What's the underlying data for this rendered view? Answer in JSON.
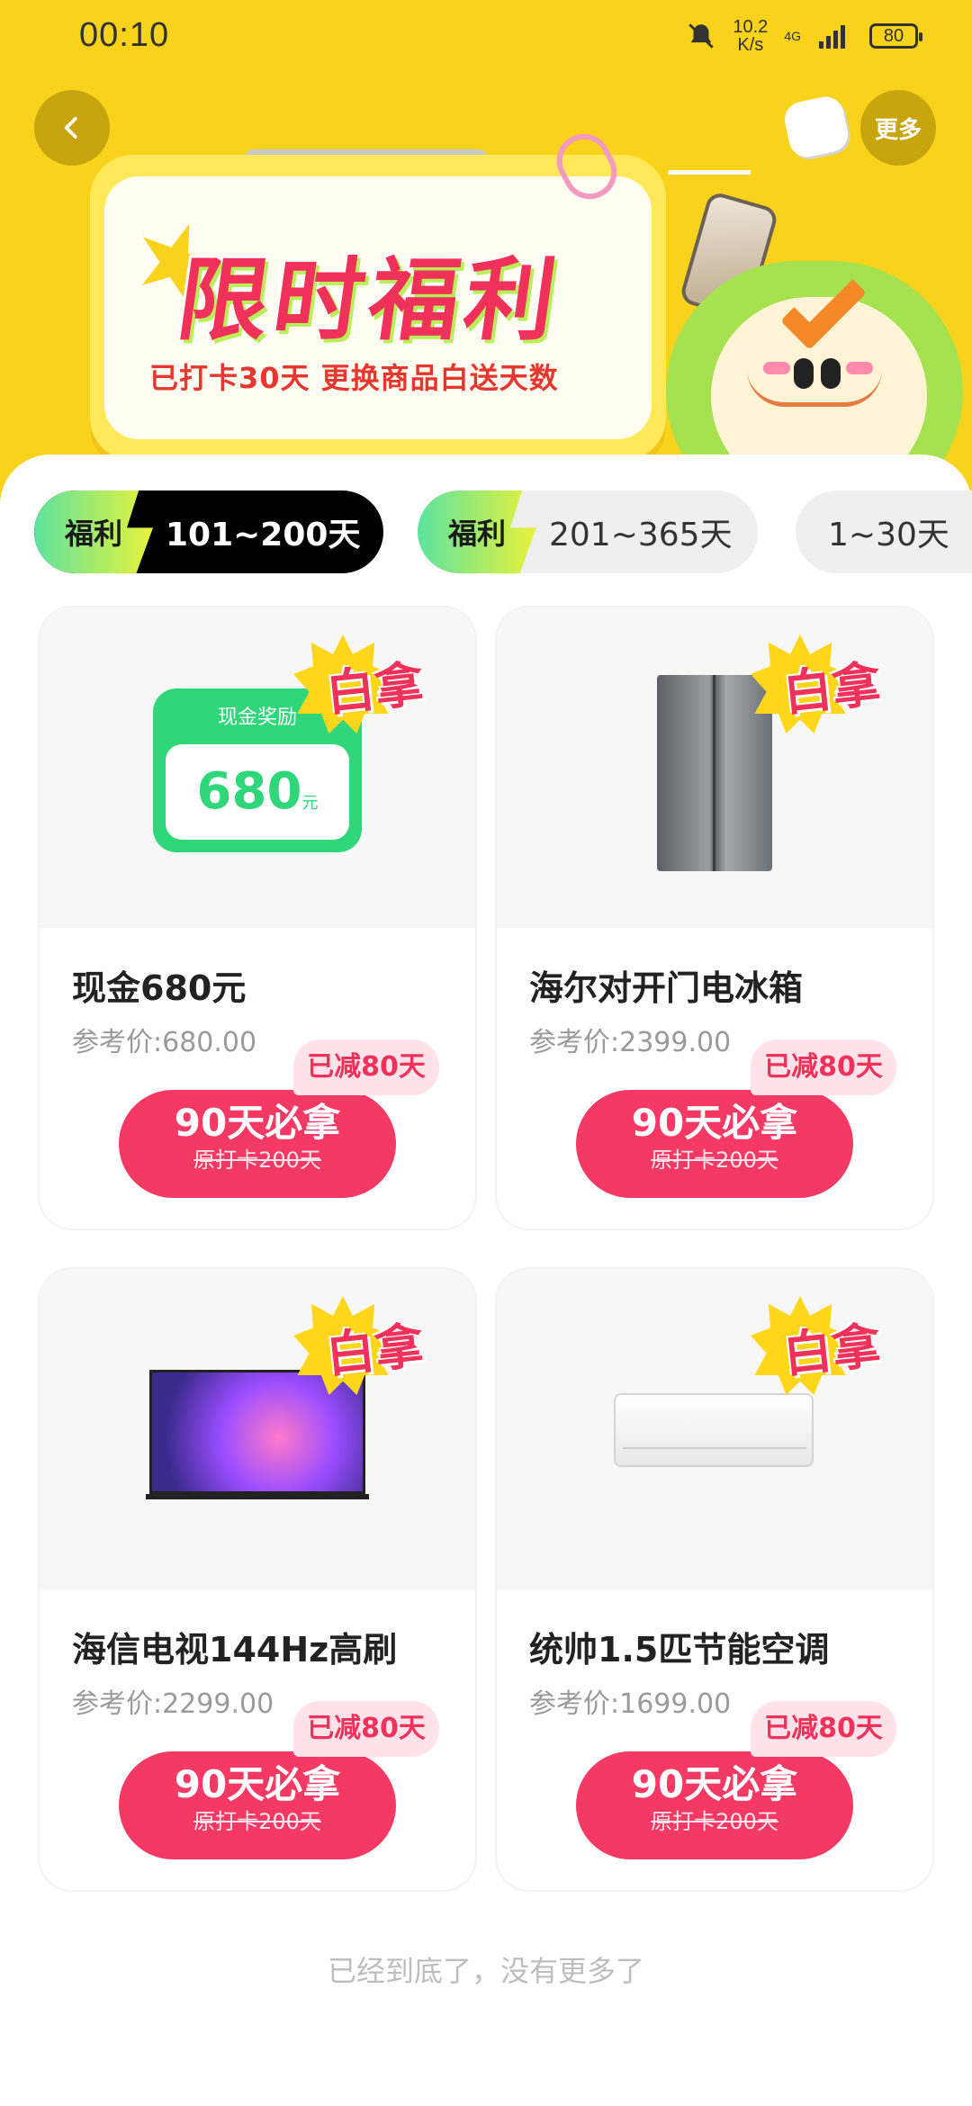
{
  "status_bar": {
    "time": "00:10",
    "net_speed_value": "10.2",
    "net_speed_unit": "K/s",
    "signal_label": "4G",
    "battery": "80"
  },
  "header": {
    "back_icon": "chevron-left-icon",
    "more_label": "更多",
    "banner_title": "限时福利",
    "banner_subtitle": "已打卡30天 更换商品白送天数"
  },
  "tabs": [
    {
      "tag": "福利",
      "label": "101~200天",
      "active": true
    },
    {
      "tag": "福利",
      "label": "201~365天",
      "active": false
    },
    {
      "tag": "",
      "label": "1~30天",
      "active": false
    }
  ],
  "badge_label": "白拿",
  "products": [
    {
      "name": "现金680元",
      "ref_price": "参考价:680.00",
      "discount": "已减80天",
      "cta_main": "90天必拿",
      "cta_sub": "原打卡200天",
      "image": {
        "type": "cash",
        "title": "现金奖励",
        "amount": "680",
        "unit": "元"
      }
    },
    {
      "name": "海尔对开门电冰箱",
      "ref_price": "参考价:2399.00",
      "discount": "已减80天",
      "cta_main": "90天必拿",
      "cta_sub": "原打卡200天",
      "image": {
        "type": "fridge"
      }
    },
    {
      "name": "海信电视144Hz高刷",
      "ref_price": "参考价:2299.00",
      "discount": "已减80天",
      "cta_main": "90天必拿",
      "cta_sub": "原打卡200天",
      "image": {
        "type": "tv"
      }
    },
    {
      "name": "统帅1.5匹节能空调",
      "ref_price": "参考价:1699.00",
      "discount": "已减80天",
      "cta_main": "90天必拿",
      "cta_sub": "原打卡200天",
      "image": {
        "type": "air-conditioner"
      }
    }
  ],
  "footer": {
    "end_text": "已经到底了，没有更多了"
  },
  "colors": {
    "header_bg": "#F9D21B",
    "accent_pink": "#F43A64",
    "cash_green": "#2FD67A"
  }
}
